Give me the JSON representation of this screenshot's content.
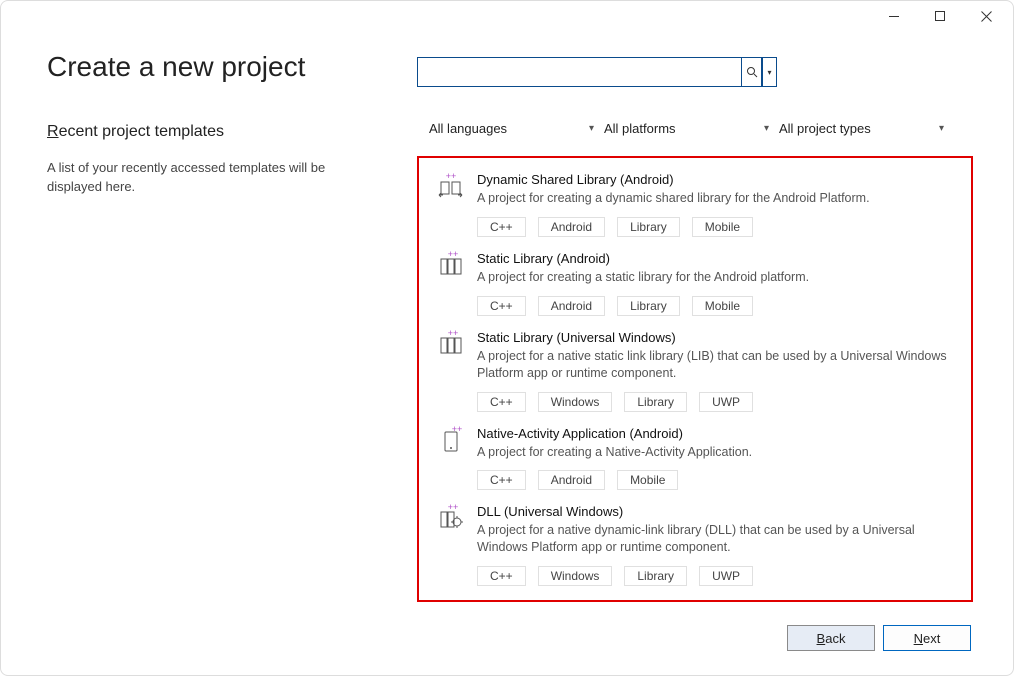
{
  "page_title": "Create a new project",
  "recent": {
    "title_prefix_under": "R",
    "title_rest": "ecent project templates",
    "desc": "A list of your recently accessed templates will be displayed here."
  },
  "search": {
    "placeholder": ""
  },
  "filters": [
    {
      "label": "All languages"
    },
    {
      "label": "All platforms"
    },
    {
      "label": "All project types"
    }
  ],
  "templates": [
    {
      "name": "Dynamic Shared Library (Android)",
      "desc": "A project for creating a dynamic shared library for the Android Platform.",
      "tags": [
        "C++",
        "Android",
        "Library",
        "Mobile"
      ]
    },
    {
      "name": "Static Library (Android)",
      "desc": "A project for creating a static library for the Android platform.",
      "tags": [
        "C++",
        "Android",
        "Library",
        "Mobile"
      ]
    },
    {
      "name": "Static Library (Universal Windows)",
      "desc": "A project for a native static link library (LIB) that can be used by a Universal Windows Platform app or runtime component.",
      "tags": [
        "C++",
        "Windows",
        "Library",
        "UWP"
      ]
    },
    {
      "name": "Native-Activity Application (Android)",
      "desc": "A project for creating a Native-Activity Application.",
      "tags": [
        "C++",
        "Android",
        "Mobile"
      ]
    },
    {
      "name": "DLL (Universal Windows)",
      "desc": "A project for a native dynamic-link library (DLL) that can be used by a Universal Windows Platform app or runtime component.",
      "tags": [
        "C++",
        "Windows",
        "Library",
        "UWP"
      ]
    }
  ],
  "buttons": {
    "back_under": "B",
    "back_rest": "ack",
    "next_under": "N",
    "next_rest": "ext"
  }
}
